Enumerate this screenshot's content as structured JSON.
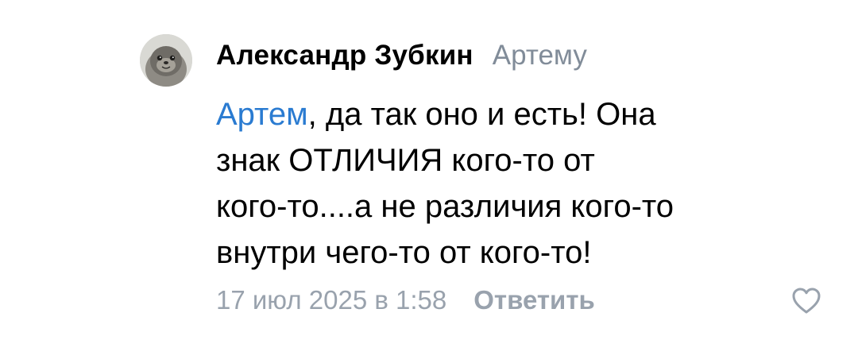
{
  "comment": {
    "author": "Александр Зубкин",
    "reply_to": "Артему",
    "mention": "Артем",
    "text_line1_rest": ", да так оно и есть! Она",
    "text_line2": "знак ОТЛИЧИЯ кого-то от",
    "text_line3": "кого-то....а не различия кого-то",
    "text_line4": "внутри чего-то от кого-то!",
    "date": "17 июл 2025 в 1:58",
    "reply_label": "Ответить",
    "like_icon": "heart-outline-icon",
    "avatar_icon": "seal-avatar"
  },
  "colors": {
    "mention": "#2a7bd1",
    "secondary_text": "#818c99",
    "footer_text": "#99a2ad"
  }
}
